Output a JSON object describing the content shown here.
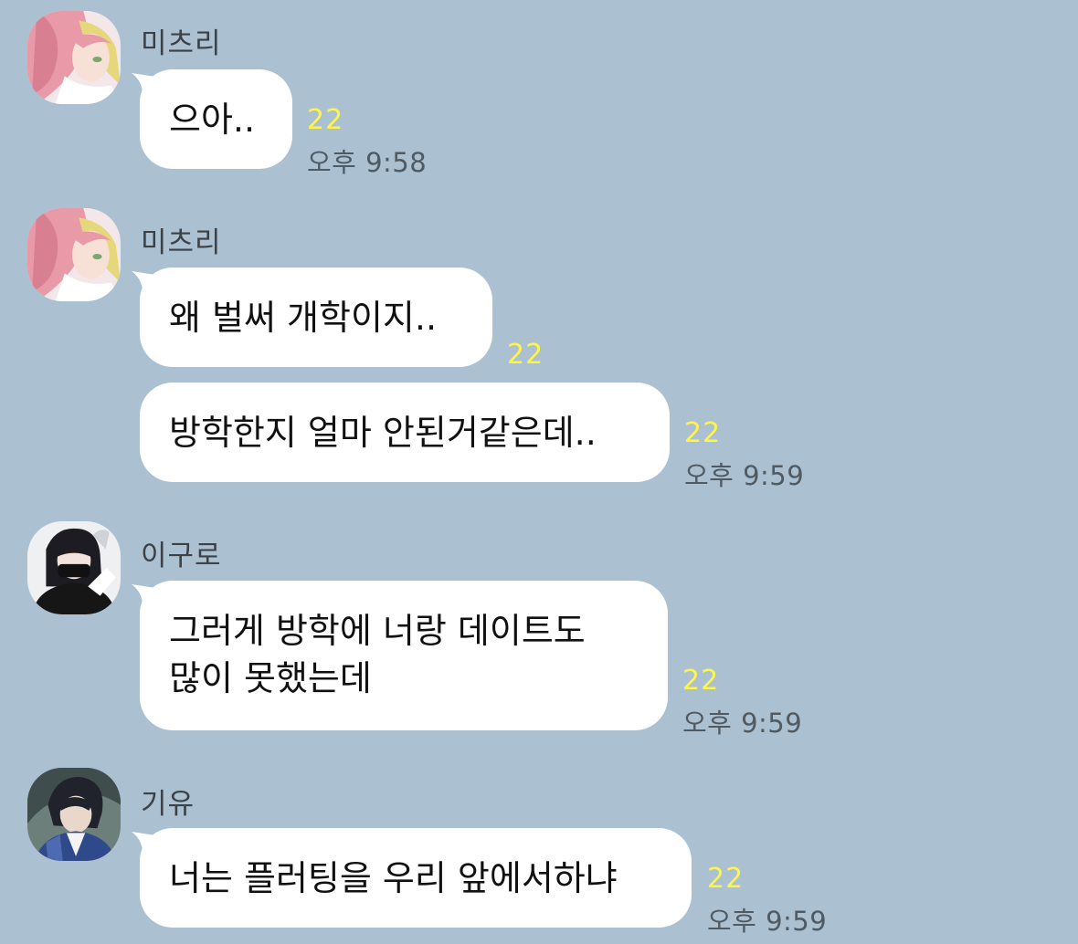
{
  "messages": [
    {
      "sender": "미츠리",
      "text": "으아..",
      "unread": "22",
      "time": "오후 9:58"
    },
    {
      "sender": "미츠리",
      "text": "왜 벌써 개학이지..",
      "unread": "22"
    },
    {
      "text": "방학한지 얼마 안된거같은데..",
      "unread": "22",
      "time": "오후 9:59"
    },
    {
      "sender": "이구로",
      "text": "그러게 방학에 너랑 데이트도\n많이 못했는데",
      "unread": "22",
      "time": "오후 9:59"
    },
    {
      "sender": "기유",
      "text": "너는 플러팅을 우리 앞에서하냐",
      "unread": "22",
      "time": "오후 9:59"
    }
  ]
}
